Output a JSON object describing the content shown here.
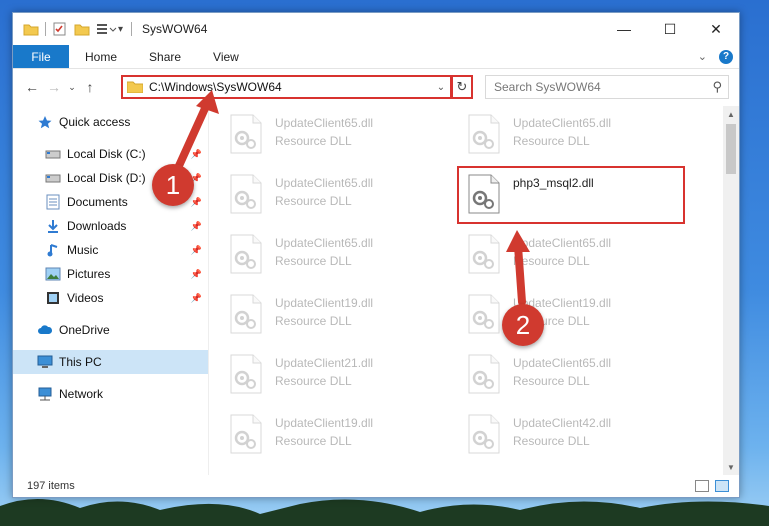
{
  "window": {
    "title": "SysWOW64",
    "controls": {
      "minimize": "—",
      "maximize": "☐",
      "close": "✕"
    }
  },
  "ribbon": {
    "tabs": [
      "File",
      "Home",
      "Share",
      "View"
    ],
    "help_label": "?"
  },
  "nav": {
    "address_path": "C:\\Windows\\SysWOW64",
    "search_placeholder": "Search SysWOW64"
  },
  "sidebar": {
    "items": [
      {
        "label": "Quick access",
        "icon": "star-icon",
        "pinned": false
      },
      {
        "label": "Local Disk (C:)",
        "icon": "drive-icon",
        "pinned": true
      },
      {
        "label": "Local Disk (D:)",
        "icon": "drive-icon",
        "pinned": true
      },
      {
        "label": "Documents",
        "icon": "documents-icon",
        "pinned": true
      },
      {
        "label": "Downloads",
        "icon": "download-icon",
        "pinned": true
      },
      {
        "label": "Music",
        "icon": "music-icon",
        "pinned": true
      },
      {
        "label": "Pictures",
        "icon": "pictures-icon",
        "pinned": true
      },
      {
        "label": "Videos",
        "icon": "videos-icon",
        "pinned": true
      },
      {
        "label": "OneDrive",
        "icon": "cloud-icon",
        "pinned": false
      },
      {
        "label": "This PC",
        "icon": "computer-icon",
        "pinned": false,
        "selected": true
      },
      {
        "label": "Network",
        "icon": "network-icon",
        "pinned": false
      }
    ]
  },
  "files": {
    "left_column": [
      {
        "name": "UpdateClient65.dll",
        "type": "Resource DLL"
      },
      {
        "name": "UpdateClient65.dll",
        "type": "Resource DLL"
      },
      {
        "name": "UpdateClient65.dll",
        "type": "Resource DLL"
      },
      {
        "name": "UpdateClient19.dll",
        "type": "Resource DLL"
      },
      {
        "name": "UpdateClient21.dll",
        "type": "Resource DLL"
      },
      {
        "name": "UpdateClient19.dll",
        "type": "Resource DLL"
      }
    ],
    "right_column": [
      {
        "name": "UpdateClient65.dll",
        "type": "Resource DLL"
      },
      {
        "name": "php3_msql2.dll",
        "type": "",
        "highlighted": true
      },
      {
        "name": "UpdateClient65.dll",
        "type": "Resource DLL"
      },
      {
        "name": "UpdateClient19.dll",
        "type": "Resource DLL"
      },
      {
        "name": "UpdateClient65.dll",
        "type": "Resource DLL"
      },
      {
        "name": "UpdateClient42.dll",
        "type": "Resource DLL"
      }
    ]
  },
  "status": {
    "item_count": "197 items"
  },
  "annotations": {
    "step1": "1",
    "step2": "2"
  },
  "colors": {
    "accent": "#1979ca",
    "annotation_red": "#d03a2f",
    "selection": "#cce4f7"
  }
}
